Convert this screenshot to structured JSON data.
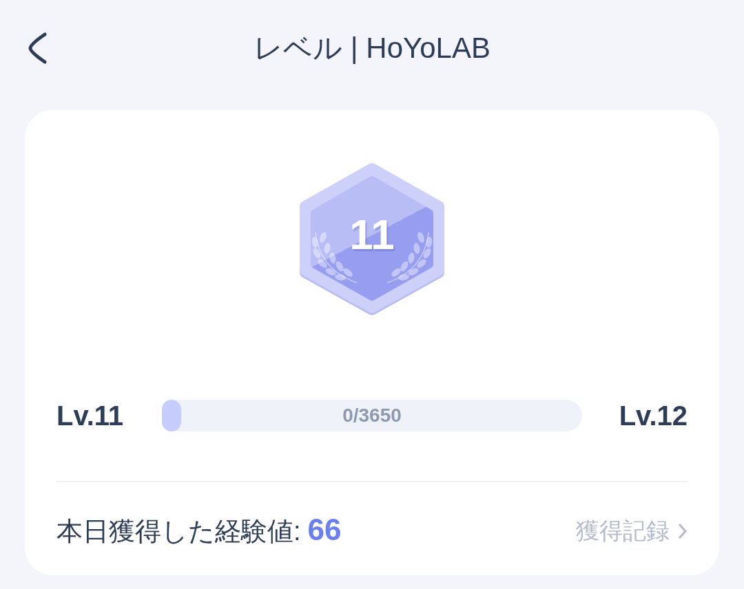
{
  "header": {
    "title": "レベル | HoYoLAB"
  },
  "level_card": {
    "badge": {
      "level_number": "11"
    },
    "progress": {
      "current_level": "Lv.11",
      "next_level": "Lv.12",
      "level": 0,
      "reading": "0/3650"
    },
    "today_exp": {
      "label": "本日獲得した経験値:",
      "value": "66"
    },
    "history_link": {
      "label": "獲得記録"
    }
  }
}
